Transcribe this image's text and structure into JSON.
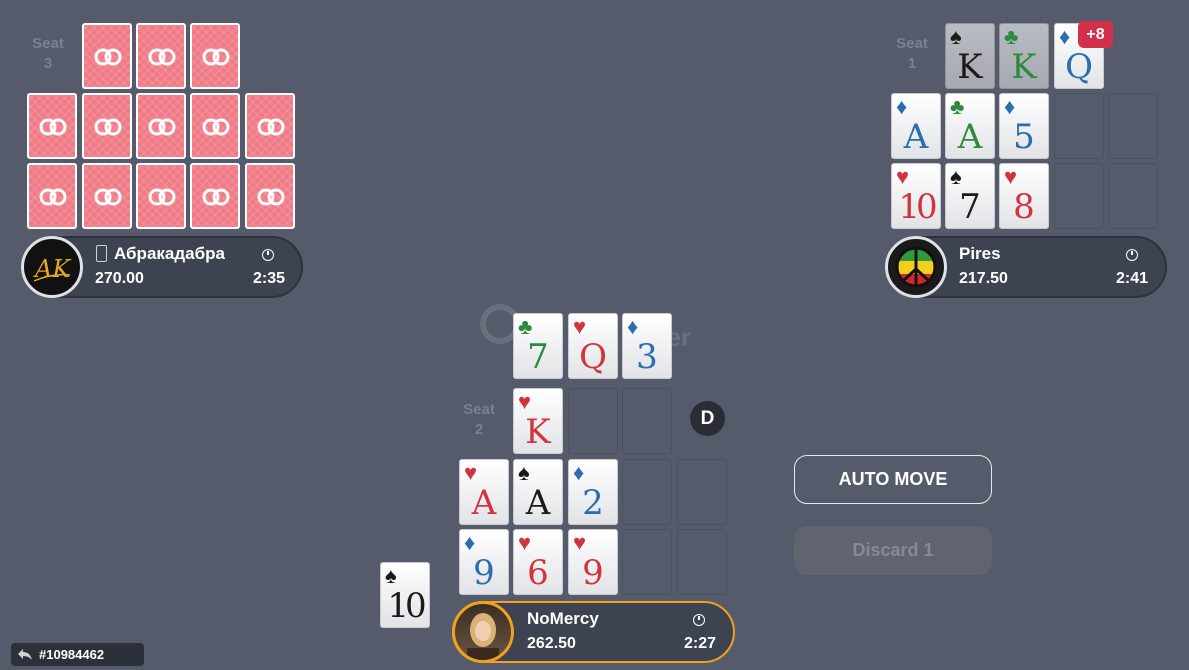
{
  "seats": {
    "seat3": {
      "label": "Seat 3",
      "name": "Абракадабра",
      "stack": "270.00",
      "time": "2:35",
      "avatar": "ak-logo-avatar"
    },
    "seat1": {
      "label": "Seat 1",
      "name": "Pires",
      "stack": "217.50",
      "time": "2:41",
      "avatar": "peace-sign-avatar",
      "extra_badge": "+8"
    },
    "seat2": {
      "label": "Seat 2",
      "name": "NoMercy",
      "stack": "262.50",
      "time": "2:27",
      "avatar": "woman-photo-avatar"
    }
  },
  "seat1_cards": {
    "top": [
      {
        "rank": "K",
        "suit": "♠"
      },
      {
        "rank": "K",
        "suit": "♣"
      },
      {
        "rank": "Q",
        "suit": "♦"
      }
    ],
    "middle": [
      {
        "rank": "A",
        "suit": "♦"
      },
      {
        "rank": "A",
        "suit": "♣"
      },
      {
        "rank": "5",
        "suit": "♦"
      }
    ],
    "bottom": [
      {
        "rank": "10",
        "suit": "♥"
      },
      {
        "rank": "7",
        "suit": "♠"
      },
      {
        "rank": "8",
        "suit": "♥"
      }
    ]
  },
  "seat2_cards": {
    "dealt": [
      {
        "rank": "7",
        "suit": "♣"
      },
      {
        "rank": "Q",
        "suit": "♥"
      },
      {
        "rank": "3",
        "suit": "♦"
      }
    ],
    "top": [
      {
        "rank": "K",
        "suit": "♥"
      }
    ],
    "middle": [
      {
        "rank": "A",
        "suit": "♥"
      },
      {
        "rank": "A",
        "suit": "♠"
      },
      {
        "rank": "2",
        "suit": "♦"
      }
    ],
    "bottom": [
      {
        "rank": "9",
        "suit": "♦"
      },
      {
        "rank": "6",
        "suit": "♥"
      },
      {
        "rank": "9",
        "suit": "♥"
      }
    ],
    "discard": {
      "rank": "10",
      "suit": "♠"
    }
  },
  "dealer_button": "D",
  "buttons": {
    "auto_move": "AUTO MOVE",
    "discard": "Discard 1"
  },
  "hand_id": "#10984462",
  "watermark": "ker",
  "colors": {
    "table": "#565b6b",
    "card_back": "#f07a85",
    "active_ring": "#f1a11d",
    "badge": "#d22f48"
  }
}
